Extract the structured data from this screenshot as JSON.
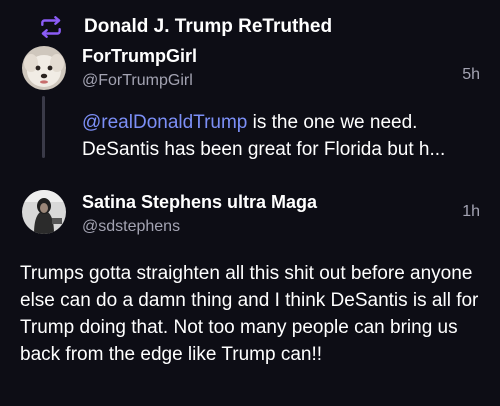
{
  "retruth": {
    "label": "Donald J. Trump ReTruthed",
    "icon": "retruth-icon"
  },
  "quoted_post": {
    "display_name": "ForTrumpGirl",
    "handle": "@ForTrumpGirl",
    "time": "5h",
    "mention": "@realDonaldTrump",
    "text_after_mention": " is the one we need.",
    "text_line2": "DeSantis has been great for Florida but h..."
  },
  "reply_post": {
    "display_name": "Satina Stephens ultra Maga",
    "handle": "@sdstephens",
    "time": "1h",
    "text": "Trumps gotta straighten all this shit out before anyone else can do a damn thing and I think DeSantis is all for Trump doing that. Not too many people can bring us back from the edge like Trump can!!"
  },
  "colors": {
    "background": "#0d0d15",
    "retruth_icon": "#8b5cf6",
    "mention": "#7c8ff6",
    "secondary_text": "#a3a3b2"
  }
}
